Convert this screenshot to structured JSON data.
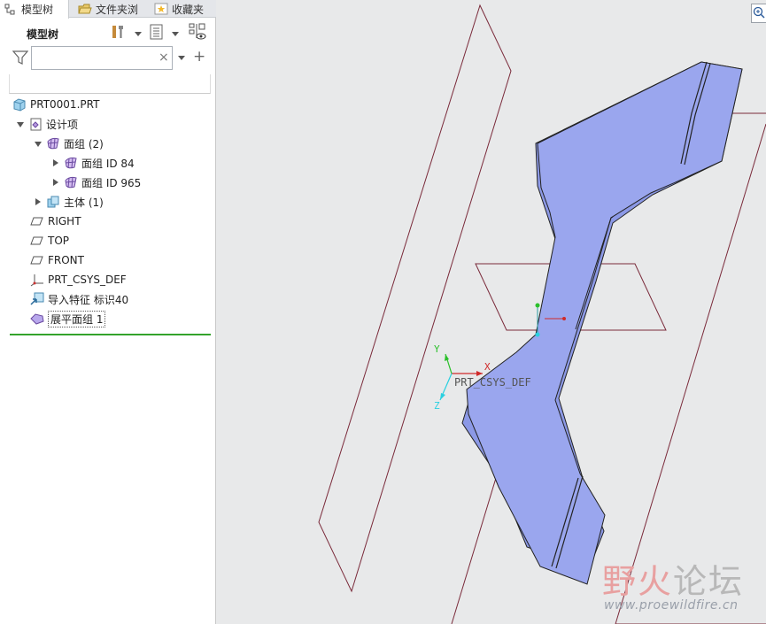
{
  "tabs": [
    {
      "label": "模型树",
      "icon": "tree-icon",
      "active": true
    },
    {
      "label": "文件夹浏",
      "icon": "folder-icon",
      "active": false
    },
    {
      "label": "收藏夹",
      "icon": "star-icon",
      "active": false
    }
  ],
  "toolbar": {
    "title": "模型树"
  },
  "search": {
    "value": "",
    "placeholder": ""
  },
  "tree": {
    "root": "PRT0001.PRT",
    "design_items": "设计项",
    "quilt_group": "面组 (2)",
    "quilt_84": "面组 ID 84",
    "quilt_965": "面组 ID 965",
    "body": "主体 (1)",
    "right": "RIGHT",
    "top": "TOP",
    "front": "FRONT",
    "csys": "PRT_CSYS_DEF",
    "import": "导入特征 标识40",
    "flatten": "展平面组 1"
  },
  "viewport": {
    "csys_label": "PRT_CSYS_DEF",
    "axis_x": "X",
    "axis_y": "Y",
    "axis_z": "Z",
    "surface_color": "#9aa6ee",
    "plane_color": "#7a2a3a"
  },
  "watermark": {
    "title_a": "野火",
    "title_b": "论坛",
    "url": "www.proewildfire.cn"
  }
}
